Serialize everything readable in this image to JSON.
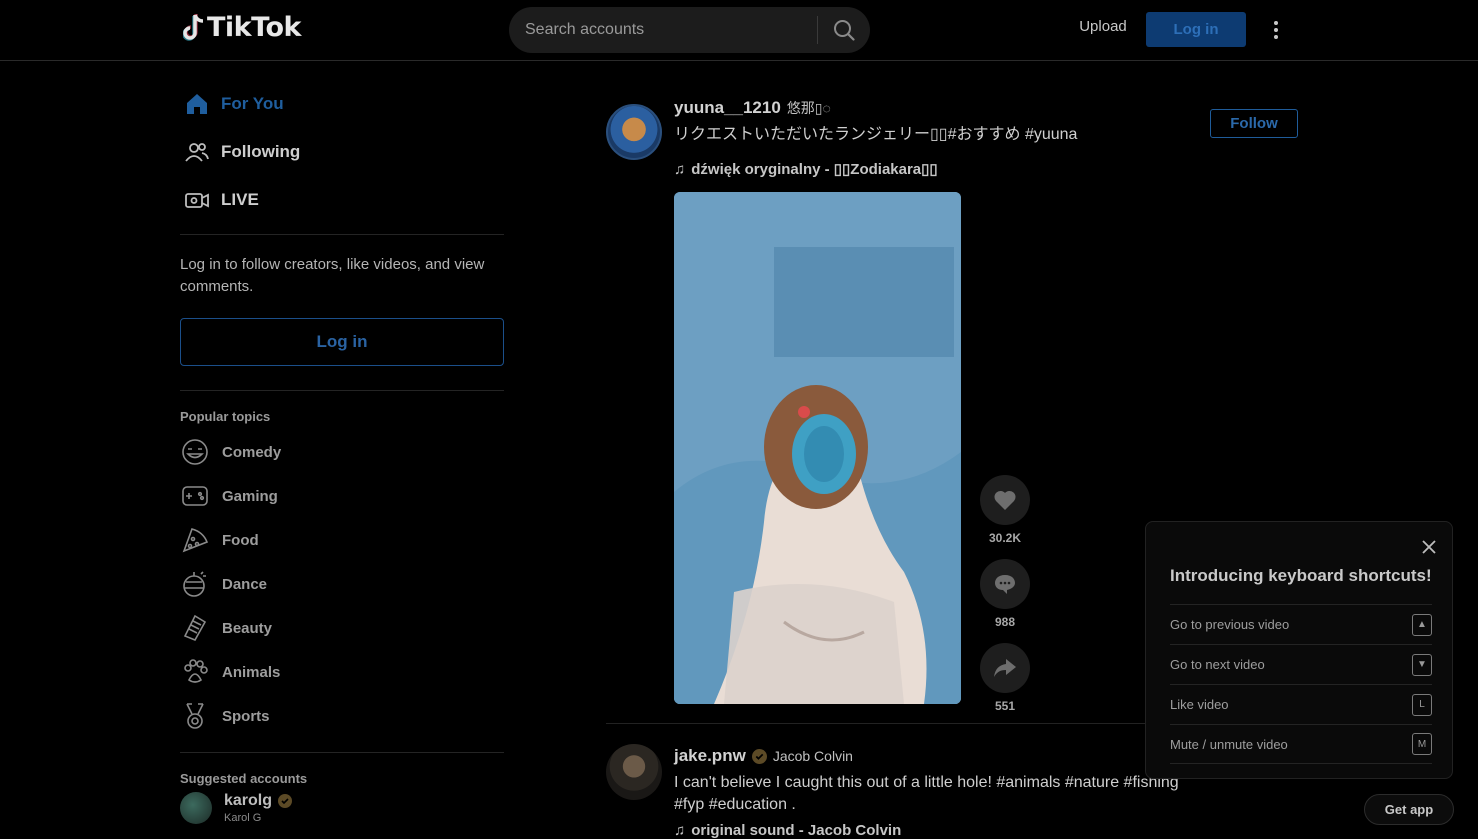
{
  "header": {
    "logo_text": "TikTok",
    "search_placeholder": "Search accounts",
    "upload_label": "Upload",
    "login_label": "Log in"
  },
  "sidebar": {
    "nav": [
      {
        "label": "For You",
        "icon": "home-icon"
      },
      {
        "label": "Following",
        "icon": "people-icon"
      },
      {
        "label": "LIVE",
        "icon": "live-icon"
      }
    ],
    "login_prompt": "Log in to follow creators, like videos, and view comments.",
    "login_label": "Log in",
    "popular_topics_title": "Popular topics",
    "topics": [
      {
        "label": "Comedy",
        "icon": "comedy-icon"
      },
      {
        "label": "Gaming",
        "icon": "gaming-icon"
      },
      {
        "label": "Food",
        "icon": "food-icon"
      },
      {
        "label": "Dance",
        "icon": "dance-icon"
      },
      {
        "label": "Beauty",
        "icon": "beauty-icon"
      },
      {
        "label": "Animals",
        "icon": "animals-icon"
      },
      {
        "label": "Sports",
        "icon": "sports-icon"
      }
    ],
    "suggested_title": "Suggested accounts",
    "suggested": [
      {
        "username": "karolg",
        "name": "Karol G",
        "verified": true
      }
    ]
  },
  "posts": [
    {
      "username": "yuuna__1210",
      "nickname": "悠那▯◌",
      "caption": "リクエストいただいたランジェリー▯▯#おすすめ #yuuna",
      "music": "dźwięk oryginalny - ▯▯Zodiakara▯▯",
      "follow_label": "Follow",
      "likes": "30.2K",
      "comments": "988",
      "shares": "551"
    },
    {
      "username": "jake.pnw",
      "nickname": "Jacob Colvin",
      "verified": true,
      "caption_line1": "I can't believe I caught this out of a little hole! #animals #nature #fishing",
      "caption_line2": "#fyp #education .",
      "music": "original sound - Jacob Colvin"
    }
  ],
  "shortcuts_panel": {
    "title": "Introducing keyboard shortcuts!",
    "items": [
      {
        "label": "Go to previous video",
        "key": "▲"
      },
      {
        "label": "Go to next video",
        "key": "▼"
      },
      {
        "label": "Like video",
        "key": "L"
      },
      {
        "label": "Mute / unmute video",
        "key": "M"
      }
    ]
  },
  "get_app_label": "Get app",
  "colors": {
    "background": "#000000",
    "accent_blue": "#1f5e9e",
    "login_bg": "#0d3b72"
  }
}
